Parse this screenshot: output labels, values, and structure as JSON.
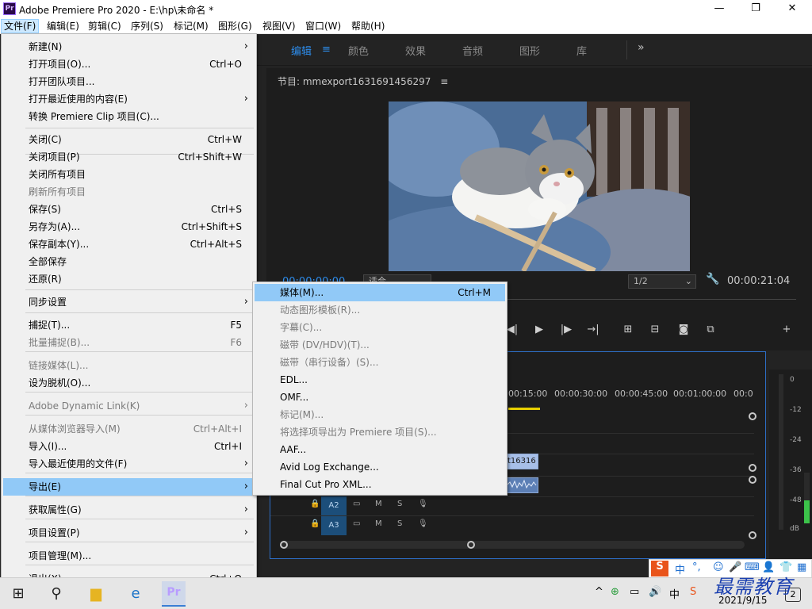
{
  "window": {
    "title": "Adobe Premiere Pro 2020 - E:\\hp\\未命名 *",
    "app_icon": "Pr",
    "controls": {
      "minimize": "—",
      "maximize": "❐",
      "close": "✕"
    }
  },
  "menubar": {
    "items": [
      "文件(F)",
      "编辑(E)",
      "剪辑(C)",
      "序列(S)",
      "标记(M)",
      "图形(G)",
      "视图(V)",
      "窗口(W)",
      "帮助(H)"
    ],
    "active": "文件(F)"
  },
  "workspaces": {
    "tabs": [
      "编辑",
      "颜色",
      "效果",
      "音频",
      "图形",
      "库"
    ],
    "active": "编辑",
    "menu_icon": "≡",
    "more": "»"
  },
  "program_monitor": {
    "title": "节目: mmexport1631691456297",
    "title_menu": "≡",
    "timecode_current": "00:00:00:00",
    "fit": "适合",
    "resolution": "1/2",
    "timecode_duration": "00:00:21:04"
  },
  "timeline": {
    "ruler": [
      "00:15:00",
      "00:00:30:00",
      "00:00:45:00",
      "00:01:00:00",
      "00:0"
    ],
    "clip_video": "t16316",
    "tracks": [
      {
        "name": "A2",
        "m": "M",
        "s": "S"
      },
      {
        "name": "A3",
        "m": "M",
        "s": "S"
      }
    ]
  },
  "audio_meter": {
    "labels": [
      "0",
      "-12",
      "-24",
      "-36",
      "-48",
      "dB"
    ],
    "level": 0.45
  },
  "file_menu": {
    "items": [
      {
        "label": "新建(N)",
        "shortcut": "",
        "submenu": true
      },
      {
        "label": "打开项目(O)...",
        "shortcut": "Ctrl+O"
      },
      {
        "label": "打开团队项目..."
      },
      {
        "label": "打开最近使用的内容(E)",
        "submenu": true
      },
      {
        "label": "转换 Premiere Clip 项目(C)..."
      },
      {
        "label": "关闭(C)",
        "shortcut": "Ctrl+W"
      },
      {
        "label": "关闭项目(P)",
        "shortcut": "Ctrl+Shift+W"
      },
      {
        "label": "关闭所有项目"
      },
      {
        "label": "刷新所有项目",
        "disabled": true
      },
      {
        "label": "保存(S)",
        "shortcut": "Ctrl+S"
      },
      {
        "label": "另存为(A)...",
        "shortcut": "Ctrl+Shift+S"
      },
      {
        "label": "保存副本(Y)...",
        "shortcut": "Ctrl+Alt+S"
      },
      {
        "label": "全部保存"
      },
      {
        "label": "还原(R)"
      },
      {
        "label": "同步设置",
        "submenu": true
      },
      {
        "label": "捕捉(T)...",
        "shortcut": "F5"
      },
      {
        "label": "批量捕捉(B)...",
        "shortcut": "F6",
        "disabled": true
      },
      {
        "label": "链接媒体(L)...",
        "disabled": true
      },
      {
        "label": "设为脱机(O)..."
      },
      {
        "label": "Adobe Dynamic Link(K)",
        "disabled": true,
        "submenu": true
      },
      {
        "label": "从媒体浏览器导入(M)",
        "shortcut": "Ctrl+Alt+I",
        "disabled": true
      },
      {
        "label": "导入(I)...",
        "shortcut": "Ctrl+I"
      },
      {
        "label": "导入最近使用的文件(F)",
        "submenu": true
      },
      {
        "label": "导出(E)",
        "submenu": true,
        "active": true
      },
      {
        "label": "获取属性(G)",
        "submenu": true
      },
      {
        "label": "项目设置(P)",
        "submenu": true
      },
      {
        "label": "项目管理(M)..."
      },
      {
        "label": "退出(X)",
        "shortcut": "Ctrl+Q"
      }
    ]
  },
  "export_menu": {
    "items": [
      {
        "label": "媒体(M)...",
        "shortcut": "Ctrl+M",
        "active": true
      },
      {
        "label": "动态图形模板(R)...",
        "disabled": true
      },
      {
        "label": "字幕(C)...",
        "disabled": true
      },
      {
        "label": "磁带 (DV/HDV)(T)...",
        "disabled": true
      },
      {
        "label": "磁带（串行设备）(S)...",
        "disabled": true
      },
      {
        "label": "EDL..."
      },
      {
        "label": "OMF..."
      },
      {
        "label": "标记(M)...",
        "disabled": true
      },
      {
        "label": "将选择项导出为 Premiere 项目(S)...",
        "disabled": true
      },
      {
        "label": "AAF..."
      },
      {
        "label": "Avid Log Exchange..."
      },
      {
        "label": "Final Cut Pro XML..."
      }
    ]
  },
  "taskbar": {
    "time": "",
    "date": "2021/9/15",
    "ime_lang": "中",
    "tray_ime": "中",
    "notification_count": "2"
  },
  "ime_bar": {
    "lang": "中",
    "punct": "°,"
  },
  "watermark": "最需教育",
  "colors": {
    "accent_blue": "#2d8ceb",
    "menu_highlight": "#91c9f7",
    "meter_green": "#3cc24a",
    "playhead_yellow": "#e8d000"
  }
}
